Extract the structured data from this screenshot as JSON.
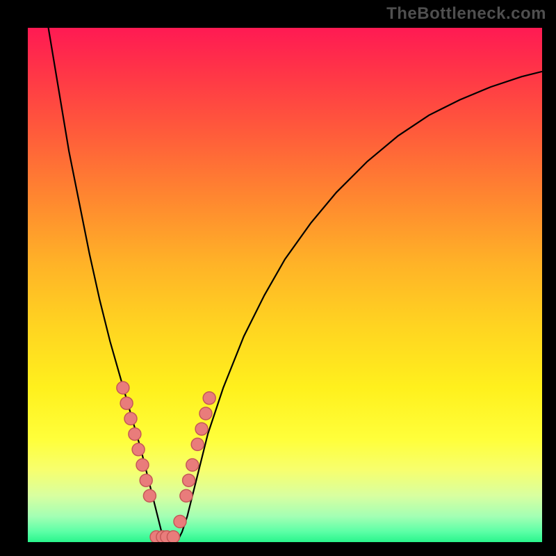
{
  "watermark": "TheBottleneck.com",
  "chart_data": {
    "type": "line",
    "title": "",
    "xlabel": "",
    "ylabel": "",
    "xlim": [
      0,
      100
    ],
    "ylim": [
      0,
      100
    ],
    "background_gradient": {
      "top": "#ff1a53",
      "mid_top": "#ff8a2f",
      "mid": "#ffd421",
      "mid_bottom": "#fff01d",
      "bottom": "#29f58c"
    },
    "series": [
      {
        "name": "bottleneck-curve",
        "kind": "line",
        "color": "#000000",
        "x": [
          4,
          6,
          8,
          10,
          12,
          14,
          16,
          18,
          20,
          22,
          24,
          25,
          26,
          27,
          28,
          29,
          30,
          31,
          32,
          33,
          35,
          38,
          42,
          46,
          50,
          55,
          60,
          66,
          72,
          78,
          84,
          90,
          96,
          100
        ],
        "y": [
          100,
          88,
          76,
          66,
          56,
          47,
          39,
          32,
          25,
          18,
          10,
          6,
          2,
          0,
          0,
          0,
          2,
          5,
          9,
          13,
          21,
          30,
          40,
          48,
          55,
          62,
          68,
          74,
          79,
          83,
          86,
          88.5,
          90.5,
          91.5
        ]
      },
      {
        "name": "highlighted-points",
        "kind": "scatter",
        "color": "#e97c7b",
        "x": [
          18.5,
          19.2,
          20.0,
          20.8,
          21.5,
          22.3,
          23.0,
          23.7,
          25.0,
          26.2,
          27.0,
          28.3,
          29.6,
          30.8,
          31.3,
          32.0,
          33.0,
          33.8,
          34.6,
          35.3
        ],
        "y": [
          30.0,
          27.0,
          24.0,
          21.0,
          18.0,
          15.0,
          12.0,
          9.0,
          1.0,
          1.0,
          1.0,
          1.0,
          4.0,
          9.0,
          12.0,
          15.0,
          19.0,
          22.0,
          25.0,
          28.0
        ]
      }
    ]
  }
}
